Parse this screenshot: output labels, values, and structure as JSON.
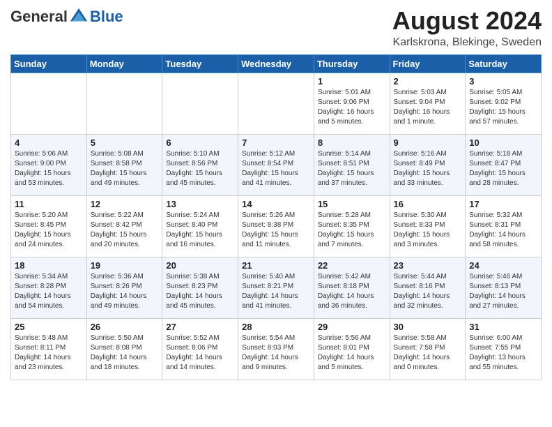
{
  "logo": {
    "general": "General",
    "blue": "Blue"
  },
  "title": "August 2024",
  "location": "Karlskrona, Blekinge, Sweden",
  "headers": [
    "Sunday",
    "Monday",
    "Tuesday",
    "Wednesday",
    "Thursday",
    "Friday",
    "Saturday"
  ],
  "weeks": [
    [
      {
        "day": "",
        "info": ""
      },
      {
        "day": "",
        "info": ""
      },
      {
        "day": "",
        "info": ""
      },
      {
        "day": "",
        "info": ""
      },
      {
        "day": "1",
        "info": "Sunrise: 5:01 AM\nSunset: 9:06 PM\nDaylight: 16 hours\nand 5 minutes."
      },
      {
        "day": "2",
        "info": "Sunrise: 5:03 AM\nSunset: 9:04 PM\nDaylight: 16 hours\nand 1 minute."
      },
      {
        "day": "3",
        "info": "Sunrise: 5:05 AM\nSunset: 9:02 PM\nDaylight: 15 hours\nand 57 minutes."
      }
    ],
    [
      {
        "day": "4",
        "info": "Sunrise: 5:06 AM\nSunset: 9:00 PM\nDaylight: 15 hours\nand 53 minutes."
      },
      {
        "day": "5",
        "info": "Sunrise: 5:08 AM\nSunset: 8:58 PM\nDaylight: 15 hours\nand 49 minutes."
      },
      {
        "day": "6",
        "info": "Sunrise: 5:10 AM\nSunset: 8:56 PM\nDaylight: 15 hours\nand 45 minutes."
      },
      {
        "day": "7",
        "info": "Sunrise: 5:12 AM\nSunset: 8:54 PM\nDaylight: 15 hours\nand 41 minutes."
      },
      {
        "day": "8",
        "info": "Sunrise: 5:14 AM\nSunset: 8:51 PM\nDaylight: 15 hours\nand 37 minutes."
      },
      {
        "day": "9",
        "info": "Sunrise: 5:16 AM\nSunset: 8:49 PM\nDaylight: 15 hours\nand 33 minutes."
      },
      {
        "day": "10",
        "info": "Sunrise: 5:18 AM\nSunset: 8:47 PM\nDaylight: 15 hours\nand 28 minutes."
      }
    ],
    [
      {
        "day": "11",
        "info": "Sunrise: 5:20 AM\nSunset: 8:45 PM\nDaylight: 15 hours\nand 24 minutes."
      },
      {
        "day": "12",
        "info": "Sunrise: 5:22 AM\nSunset: 8:42 PM\nDaylight: 15 hours\nand 20 minutes."
      },
      {
        "day": "13",
        "info": "Sunrise: 5:24 AM\nSunset: 8:40 PM\nDaylight: 15 hours\nand 16 minutes."
      },
      {
        "day": "14",
        "info": "Sunrise: 5:26 AM\nSunset: 8:38 PM\nDaylight: 15 hours\nand 11 minutes."
      },
      {
        "day": "15",
        "info": "Sunrise: 5:28 AM\nSunset: 8:35 PM\nDaylight: 15 hours\nand 7 minutes."
      },
      {
        "day": "16",
        "info": "Sunrise: 5:30 AM\nSunset: 8:33 PM\nDaylight: 15 hours\nand 3 minutes."
      },
      {
        "day": "17",
        "info": "Sunrise: 5:32 AM\nSunset: 8:31 PM\nDaylight: 14 hours\nand 58 minutes."
      }
    ],
    [
      {
        "day": "18",
        "info": "Sunrise: 5:34 AM\nSunset: 8:28 PM\nDaylight: 14 hours\nand 54 minutes."
      },
      {
        "day": "19",
        "info": "Sunrise: 5:36 AM\nSunset: 8:26 PM\nDaylight: 14 hours\nand 49 minutes."
      },
      {
        "day": "20",
        "info": "Sunrise: 5:38 AM\nSunset: 8:23 PM\nDaylight: 14 hours\nand 45 minutes."
      },
      {
        "day": "21",
        "info": "Sunrise: 5:40 AM\nSunset: 8:21 PM\nDaylight: 14 hours\nand 41 minutes."
      },
      {
        "day": "22",
        "info": "Sunrise: 5:42 AM\nSunset: 8:18 PM\nDaylight: 14 hours\nand 36 minutes."
      },
      {
        "day": "23",
        "info": "Sunrise: 5:44 AM\nSunset: 8:16 PM\nDaylight: 14 hours\nand 32 minutes."
      },
      {
        "day": "24",
        "info": "Sunrise: 5:46 AM\nSunset: 8:13 PM\nDaylight: 14 hours\nand 27 minutes."
      }
    ],
    [
      {
        "day": "25",
        "info": "Sunrise: 5:48 AM\nSunset: 8:11 PM\nDaylight: 14 hours\nand 23 minutes."
      },
      {
        "day": "26",
        "info": "Sunrise: 5:50 AM\nSunset: 8:08 PM\nDaylight: 14 hours\nand 18 minutes."
      },
      {
        "day": "27",
        "info": "Sunrise: 5:52 AM\nSunset: 8:06 PM\nDaylight: 14 hours\nand 14 minutes."
      },
      {
        "day": "28",
        "info": "Sunrise: 5:54 AM\nSunset: 8:03 PM\nDaylight: 14 hours\nand 9 minutes."
      },
      {
        "day": "29",
        "info": "Sunrise: 5:56 AM\nSunset: 8:01 PM\nDaylight: 14 hours\nand 5 minutes."
      },
      {
        "day": "30",
        "info": "Sunrise: 5:58 AM\nSunset: 7:58 PM\nDaylight: 14 hours\nand 0 minutes."
      },
      {
        "day": "31",
        "info": "Sunrise: 6:00 AM\nSunset: 7:55 PM\nDaylight: 13 hours\nand 55 minutes."
      }
    ]
  ]
}
